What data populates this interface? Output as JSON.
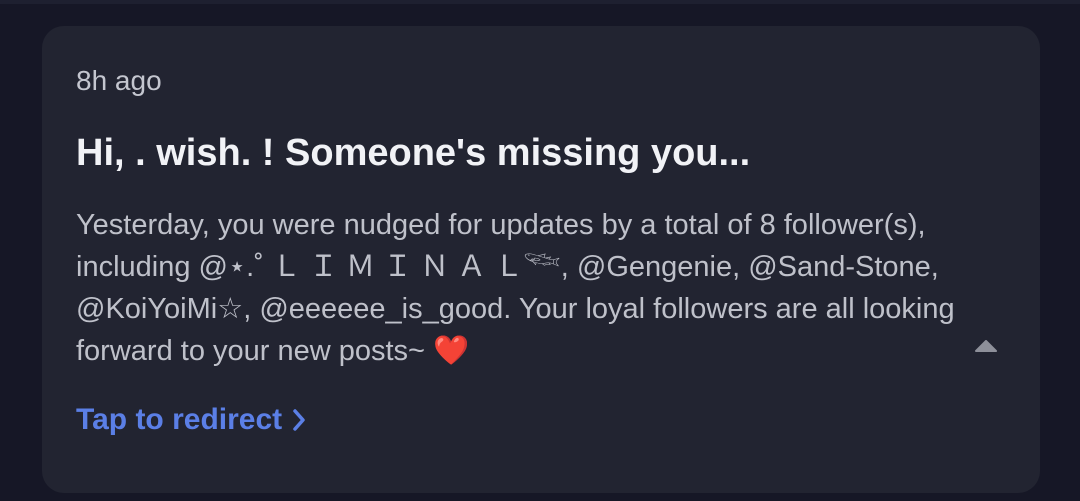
{
  "notification": {
    "time": "8h ago",
    "title": "Hi, . wish. ! Someone's missing you...",
    "body": {
      "text": "Yesterday, you were nudged for updates by a total of 8 follower(s), including @⋆.˚ Ｌ Ｉ Ｍ Ｉ Ｎ Ａ Ｌ𓆝, @Gengenie, @Sand-Stone, @KoiYoiMi☆, @eeeeee_is_good. Your loyal followers are all looking forward to your new posts~",
      "emoji": "❤️"
    },
    "link_label": "Tap to redirect",
    "collapse_icon": "caret-up-icon",
    "link_icon": "chevron-right-icon"
  },
  "colors": {
    "background": "#161726",
    "card": "#222431",
    "title": "#f1f2f6",
    "body": "#bfc1ca",
    "link": "#5b7fe6"
  }
}
